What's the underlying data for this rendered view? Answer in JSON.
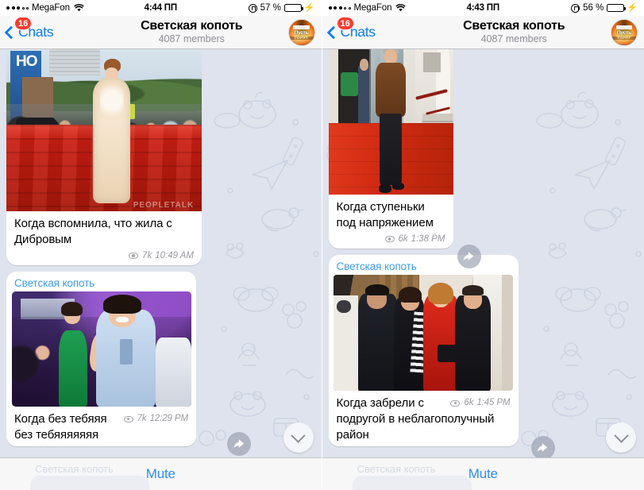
{
  "screens": [
    {
      "id": "left",
      "status_bar": {
        "carrier": "MegaFon",
        "signal_filled": 3,
        "signal_total": 5,
        "wifi_icon": "wifi-icon",
        "time": "4:44 ПП",
        "orientation_lock_icon": "rotation-lock-icon",
        "battery_percent": "57 %",
        "battery_level": 57,
        "charging_icon": "lightning-bolt-icon",
        "battery_color": "#fdd017"
      },
      "nav_bar": {
        "back_label": "Chats",
        "back_icon": "chevron-left-icon",
        "unread_badge": "16",
        "badge_color": "#fb3b30",
        "title": "Светская копоть",
        "subtitle": "4087 members",
        "avatar_name": "channel-avatar"
      },
      "messages": [
        {
          "channel_label": null,
          "photo_name": "photo-red-carpet-woman",
          "photo_watermark": "PEOPLETALK",
          "caption": "Когда вспомнила, что жила с Дибровым",
          "views": "7k",
          "time": "10:49 AM",
          "view_icon": "eye-icon",
          "forward_icon": "forward-arrow-icon"
        },
        {
          "channel_label": "Светская копоть",
          "photo_name": "photo-party-crowd",
          "caption": "Когда без тебяяя без тебяяяяяяя",
          "views": "7k",
          "time": "12:29 PM",
          "view_icon": "eye-icon",
          "forward_icon": "forward-arrow-icon"
        }
      ],
      "scroll_down_icon": "chevron-down-icon",
      "bottom_bar": {
        "mute_label": "Mute",
        "mute_color": "#2f8ef4",
        "ghost_text": "Светская копоть"
      }
    },
    {
      "id": "right",
      "status_bar": {
        "carrier": "MegaFon",
        "signal_filled": 3,
        "signal_total": 5,
        "wifi_icon": "wifi-icon",
        "time": "4:43 ПП",
        "orientation_lock_icon": "rotation-lock-icon",
        "battery_percent": "56 %",
        "battery_level": 56,
        "charging_icon": "lightning-bolt-icon",
        "battery_color": "#fdd017"
      },
      "nav_bar": {
        "back_label": "Chats",
        "back_icon": "chevron-left-icon",
        "unread_badge": "16",
        "badge_color": "#fb3b30",
        "title": "Светская копоть",
        "subtitle": "4087 members",
        "avatar_name": "channel-avatar"
      },
      "messages": [
        {
          "channel_label": null,
          "photo_name": "photo-man-red-carpet-steps",
          "photo_watermark": null,
          "caption": "Когда ступеньки под напряжением",
          "views": "6k",
          "time": "1:38 PM",
          "view_icon": "eye-icon",
          "forward_icon": "forward-arrow-icon"
        },
        {
          "channel_label": "Светская копоть",
          "photo_name": "photo-four-people",
          "caption": "Когда забрели с подругой в неблагополучный район",
          "views": "6k",
          "time": "1:45 PM",
          "view_icon": "eye-icon",
          "forward_icon": "forward-arrow-icon"
        }
      ],
      "scroll_down_icon": "chevron-down-icon",
      "bottom_bar": {
        "mute_label": "Mute",
        "mute_color": "#2f8ef4",
        "ghost_text": "Светская копоть"
      }
    }
  ],
  "theme": {
    "chat_background": "#dfe3ed",
    "bubble_background": "#ffffff",
    "accent_blue": "#0b7bf7",
    "channel_label_color": "#3e9bea",
    "meta_color": "#9a9aa0"
  }
}
